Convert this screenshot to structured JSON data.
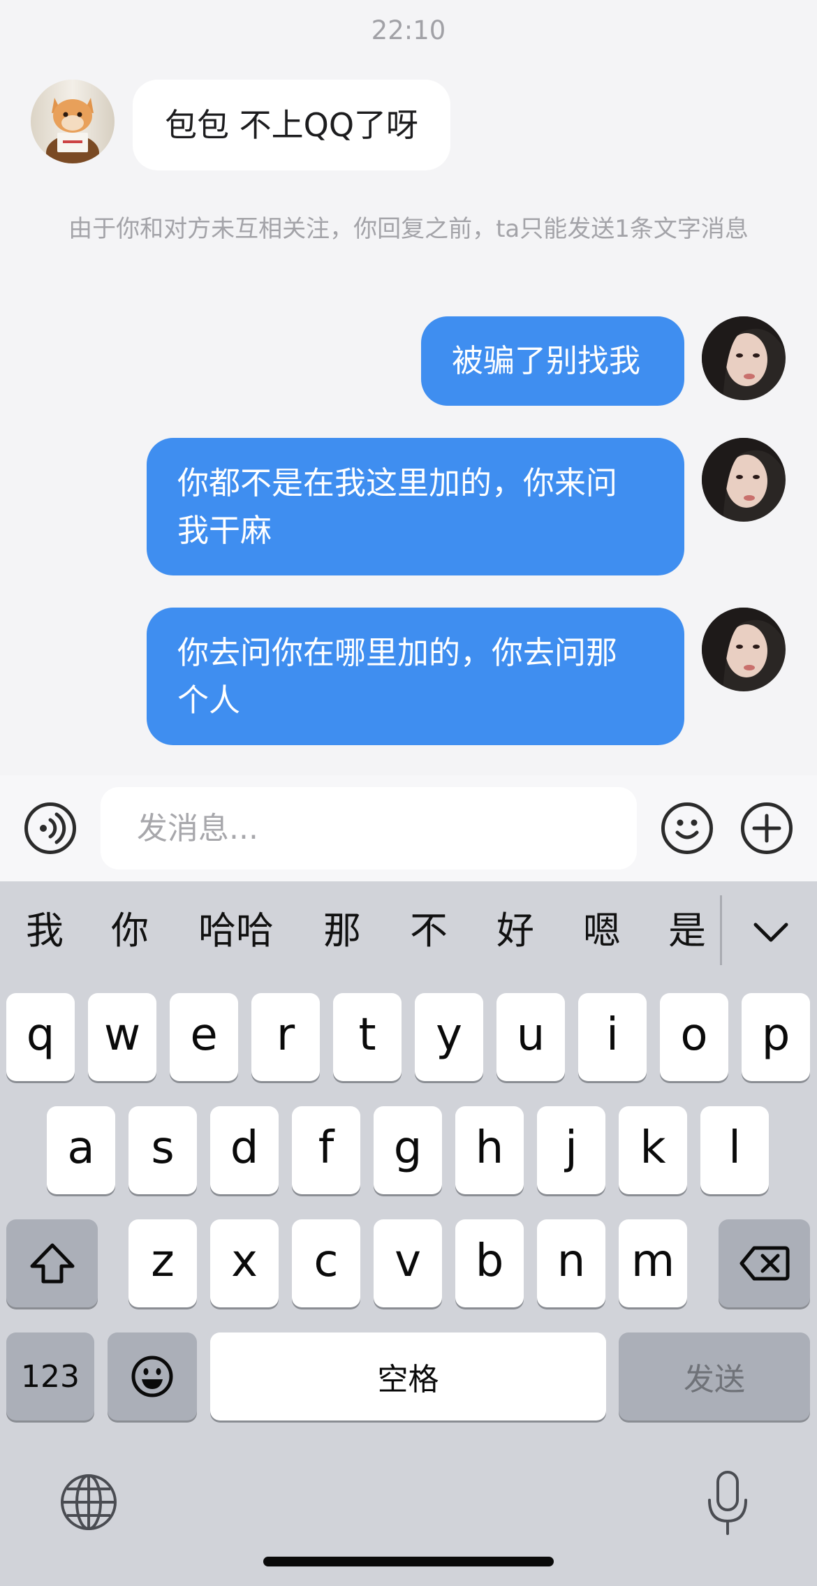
{
  "chat": {
    "timestamp": "22:10",
    "incoming_message": "包包 不上QQ了呀",
    "system_notice": "由于你和对方未互相关注，你回复之前，ta只能发送1条文字消息",
    "outgoing_messages": [
      {
        "line1": "被骗了别找我",
        "line2": ""
      },
      {
        "line1": "你都不是在我这里加的，你来问",
        "line2": "我干麻"
      },
      {
        "line1": "你去问你在哪里加的，你去问那",
        "line2": "个人"
      }
    ]
  },
  "input_bar": {
    "placeholder": "发消息...",
    "voice_icon": "voice-icon",
    "emoji_icon": "emoji-icon",
    "plus_icon": "plus-icon"
  },
  "keyboard": {
    "candidates": [
      "我",
      "你",
      "哈哈",
      "那",
      "不",
      "好",
      "嗯",
      "是"
    ],
    "row1": [
      "q",
      "w",
      "e",
      "r",
      "t",
      "y",
      "u",
      "i",
      "o",
      "p"
    ],
    "row2": [
      "a",
      "s",
      "d",
      "f",
      "g",
      "h",
      "j",
      "k",
      "l"
    ],
    "row3": [
      "z",
      "x",
      "c",
      "v",
      "b",
      "n",
      "m"
    ],
    "numbers_label": "123",
    "space_label": "空格",
    "send_label": "发送",
    "icons": {
      "collapse": "chevron-down-icon",
      "shift": "shift-icon",
      "delete": "backspace-icon",
      "emoji": "emoji-keyboard-icon",
      "globe": "globe-icon",
      "mic": "microphone-icon"
    }
  },
  "colors": {
    "outgoing_bubble": "#3f8ef0",
    "chat_background": "#f4f4f6",
    "keyboard_background": "#d1d3d9"
  }
}
